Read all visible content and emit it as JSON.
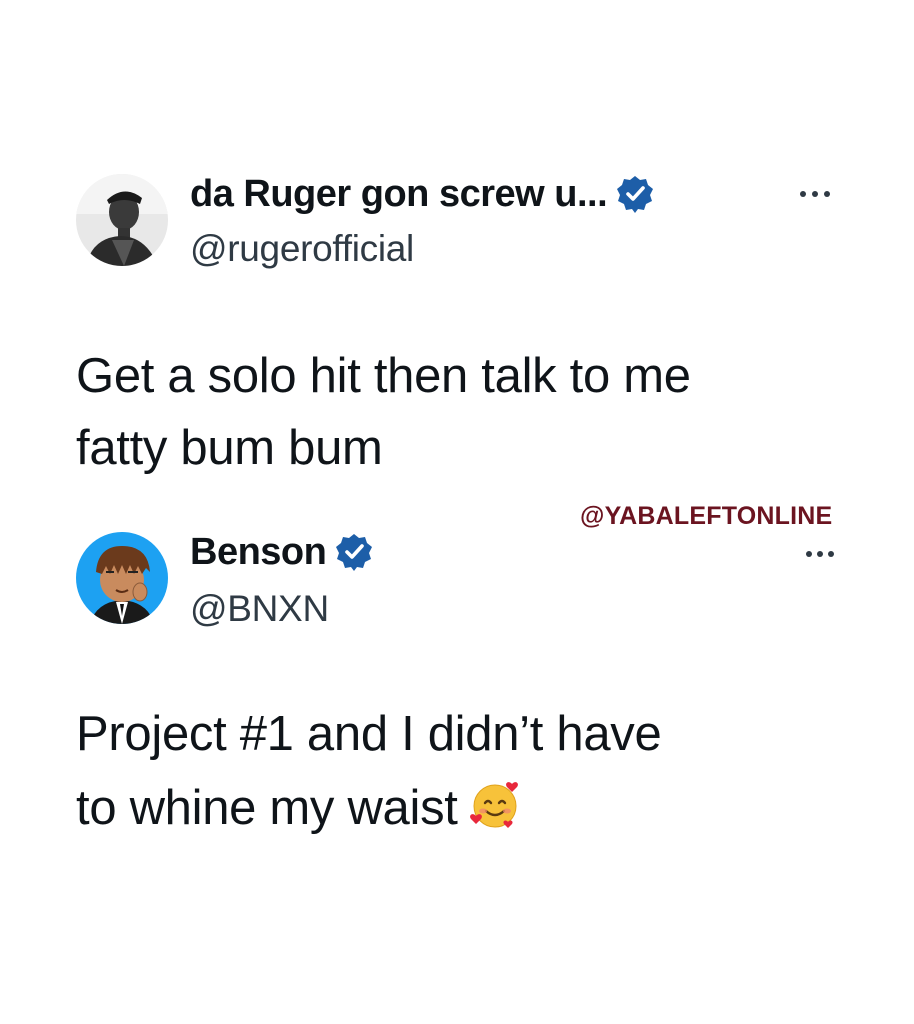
{
  "tweets": [
    {
      "display_name": "da Ruger gon screw u...",
      "handle": "@rugerofficial",
      "text_lines": [
        "Get a solo hit then talk to me",
        "fatty bum bum"
      ],
      "verified": true,
      "avatar_icon": "bw-portrait-avatar"
    },
    {
      "display_name": "Benson",
      "handle": "@BNXN",
      "text_lines": [
        "Project #1 and I didn’t have",
        "to whine my waist"
      ],
      "verified": true,
      "avatar_icon": "cartoon-avatar",
      "trailing_emoji": "smiling-face-with-hearts-icon"
    }
  ],
  "watermark": "@YABALEFTONLINE",
  "colors": {
    "text": "#0f1419",
    "secondary_text": "#2f3a44",
    "verified_badge": "#1d9bf0",
    "watermark": "#6b1420",
    "avatar_bg_blue": "#1da1f2"
  }
}
